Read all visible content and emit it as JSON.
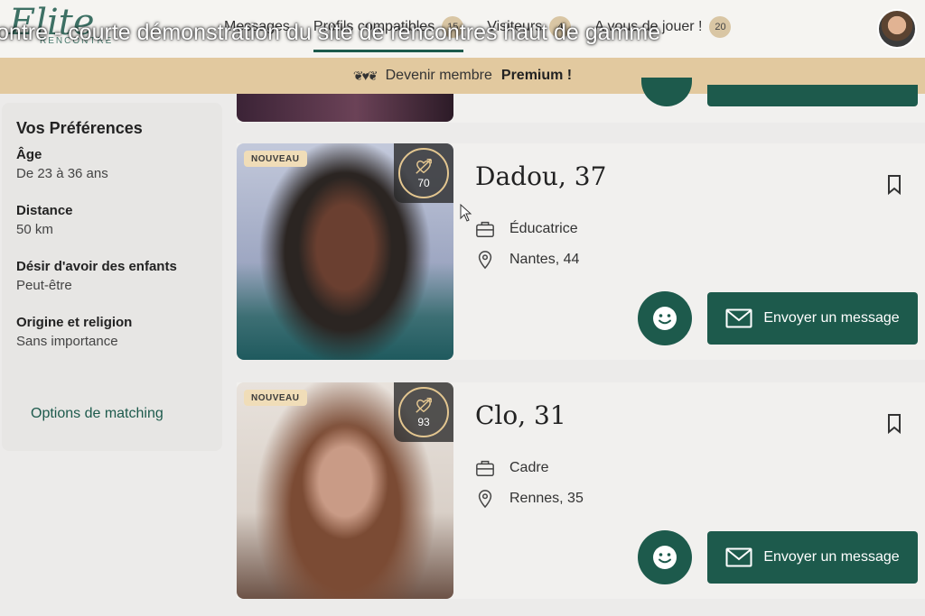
{
  "header": {
    "logo": "Elite",
    "logo_sub": "RENCONTRE",
    "overlay_title": "ontre - courte démonstration du site de rencontres haut de gamme",
    "nav": [
      {
        "label": "Messages",
        "badge": ""
      },
      {
        "label": "Profils compatibles",
        "badge": "15"
      },
      {
        "label": "Visiteurs",
        "badge": "4"
      },
      {
        "label": "A vous de jouer !",
        "badge": "20"
      }
    ]
  },
  "premium": {
    "text": "Devenir membre",
    "strong": "Premium !"
  },
  "sidebar": {
    "title": "Vos Préférences",
    "prefs": [
      {
        "label": "Âge",
        "value": "De 23 à 36 ans"
      },
      {
        "label": "Distance",
        "value": "50 km"
      },
      {
        "label": "Désir d'avoir des enfants",
        "value": "Peut-être"
      },
      {
        "label": "Origine et religion",
        "value": "Sans importance"
      }
    ],
    "link": "Options de matching"
  },
  "profiles": [
    {
      "badge": "NOUVEAU",
      "score": "70",
      "name": "Dadou, 37",
      "job": "Éducatrice",
      "location": "Nantes, 44",
      "message_label": "Envoyer un message"
    },
    {
      "badge": "NOUVEAU",
      "score": "93",
      "name": "Clo, 31",
      "job": "Cadre",
      "location": "Rennes, 35",
      "message_label": "Envoyer un message"
    }
  ],
  "colors": {
    "accent": "#1d5a4c",
    "gold": "#e2c99f",
    "badge": "#f0ddb8"
  }
}
